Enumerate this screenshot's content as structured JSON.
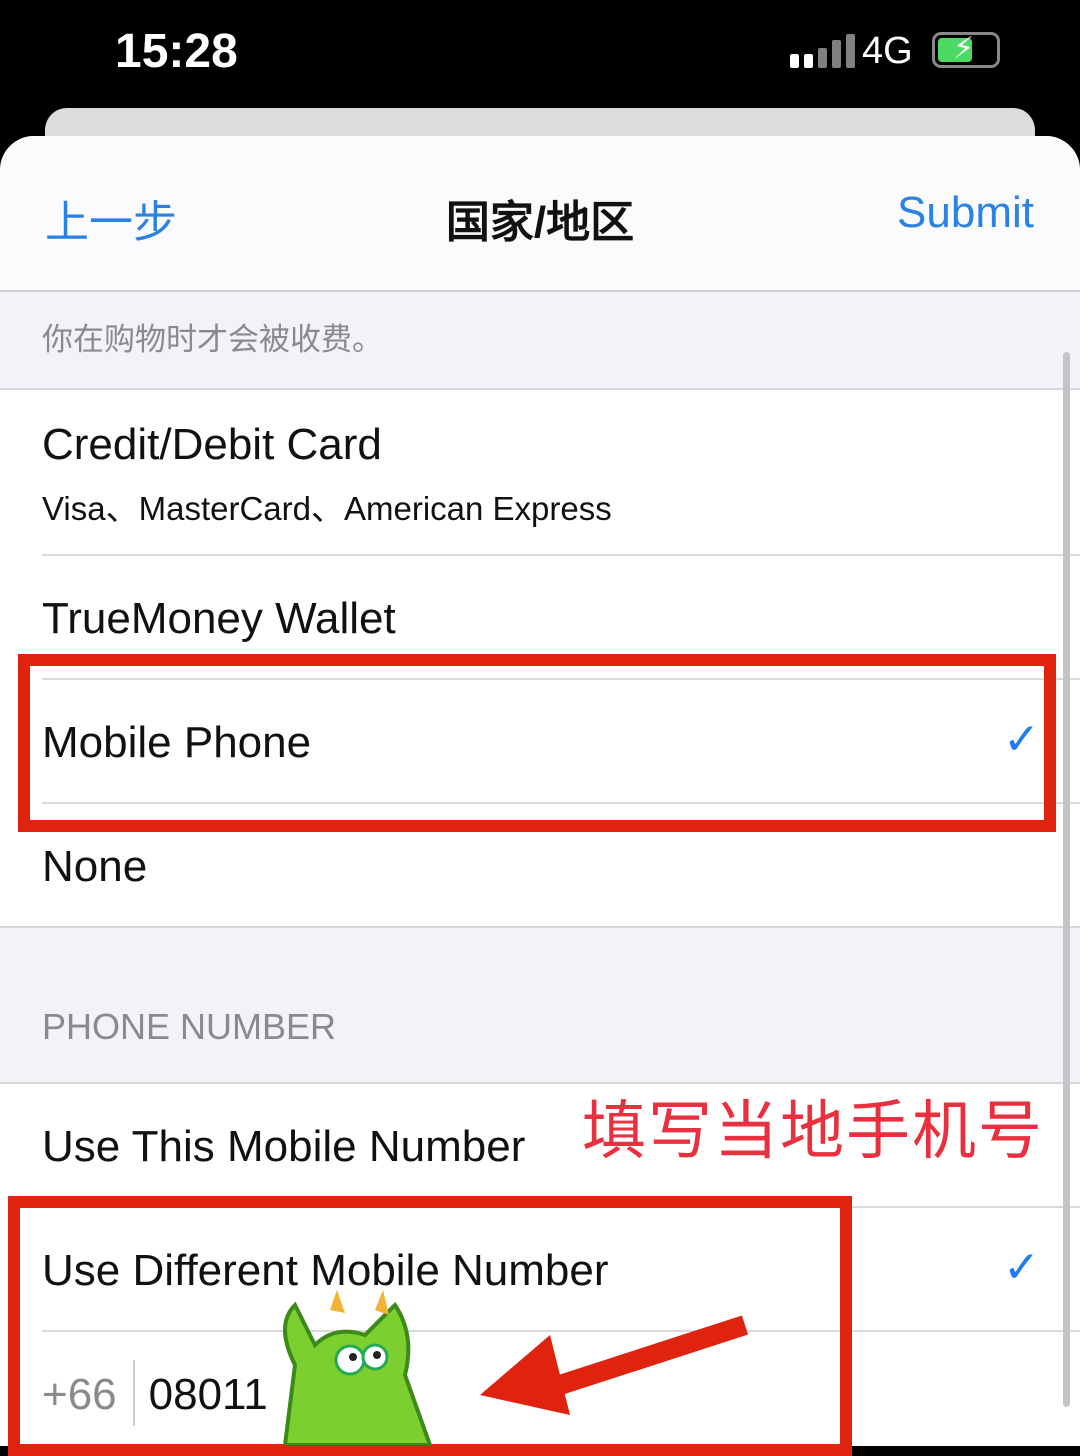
{
  "status": {
    "time": "15:28",
    "network": "4G",
    "battery_level": "charging"
  },
  "nav": {
    "back": "上一步",
    "title": "国家/地区",
    "submit": "Submit"
  },
  "note": "你在购物时才会被收费。",
  "payment_methods": [
    {
      "label": "Credit/Debit Card",
      "sub": "Visa、MasterCard、American Express",
      "selected": false
    },
    {
      "label": "TrueMoney Wallet",
      "selected": false
    },
    {
      "label": "Mobile Phone",
      "selected": true
    },
    {
      "label": "None",
      "selected": false
    }
  ],
  "phone_section": {
    "header": "PHONE NUMBER",
    "options": [
      {
        "label": "Use This Mobile Number",
        "selected": false
      },
      {
        "label": "Use Different Mobile Number",
        "selected": true
      }
    ],
    "country_code": "+66",
    "number": "08011"
  },
  "annotation": "填写当地手机号",
  "colors": {
    "accent": "#2a82e4",
    "highlight": "#e0230f",
    "annotation": "#e8303e"
  }
}
